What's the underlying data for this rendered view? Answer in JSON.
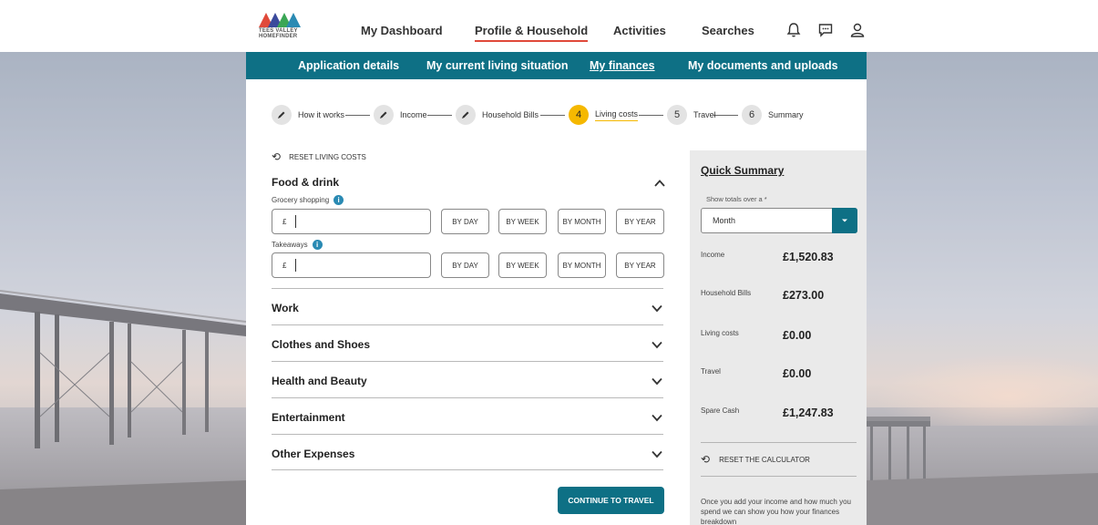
{
  "header": {
    "logo_text_line1": "TEES VALLEY",
    "logo_text_line2": "HOMEFINDER",
    "nav": [
      {
        "label": "My Dashboard"
      },
      {
        "label": "Profile & Household"
      },
      {
        "label": "Activities"
      },
      {
        "label": "Searches"
      }
    ],
    "icons": [
      "bell-icon",
      "chat-icon",
      "user-icon"
    ]
  },
  "subnav": {
    "items": [
      {
        "label": "Application details"
      },
      {
        "label": "My current living situation"
      },
      {
        "label": "My finances"
      },
      {
        "label": "My documents and uploads"
      }
    ],
    "active": "My finances"
  },
  "stepper": {
    "steps": [
      {
        "label": "How it works",
        "state": "done"
      },
      {
        "label": "Income",
        "state": "done"
      },
      {
        "label": "Household Bills",
        "state": "done"
      },
      {
        "label": "Living costs",
        "number": "4",
        "state": "current"
      },
      {
        "label": "Travel",
        "number": "5",
        "state": "todo"
      },
      {
        "label": "Summary",
        "number": "6",
        "state": "todo"
      }
    ]
  },
  "living_costs": {
    "reset_label": "RESET LIVING COSTS",
    "food_title": "Food & drink",
    "fields": [
      {
        "label": "Grocery shopping",
        "currency": "£",
        "value": ""
      },
      {
        "label": "Takeaways",
        "currency": "£",
        "value": ""
      }
    ],
    "period_buttons": [
      "BY DAY",
      "BY WEEK",
      "BY MONTH",
      "BY YEAR"
    ],
    "sections": [
      {
        "title": "Work"
      },
      {
        "title": "Clothes and Shoes"
      },
      {
        "title": "Health and Beauty"
      },
      {
        "title": "Entertainment"
      },
      {
        "title": "Other Expenses"
      }
    ],
    "continue_label": "CONTINUE TO TRAVEL"
  },
  "quick_summary": {
    "title": "Quick Summary",
    "totals_label": "Show totals over a *",
    "totals_value": "Month",
    "rows": [
      {
        "label": "Income",
        "value": "£1,520.83"
      },
      {
        "label": "Household Bills",
        "value": "£273.00"
      },
      {
        "label": "Living costs",
        "value": "£0.00"
      },
      {
        "label": "Travel",
        "value": "£0.00"
      },
      {
        "label": "Spare Cash",
        "value": "£1,247.83"
      }
    ],
    "reset_label": "RESET THE CALCULATOR",
    "note": "Once you add your income and how much you spend we can show you how your finances breakdown"
  },
  "colors": {
    "primary": "#0e7085",
    "accent_step": "#f5b800",
    "nav_underline": "#e0493a",
    "info": "#2a8ab3"
  }
}
